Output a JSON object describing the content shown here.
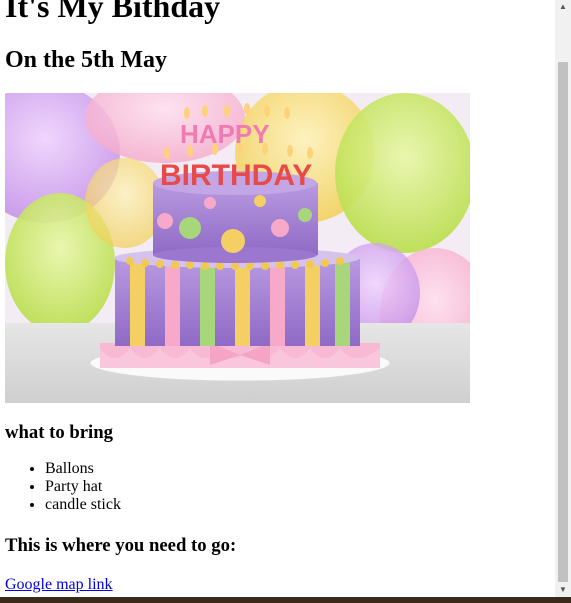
{
  "page": {
    "title": "It's My Bithday",
    "subtitle": "On the 5th May",
    "bring_heading": "what to bring",
    "bring_items": [
      "Ballons",
      "Party hat",
      "candle stick"
    ],
    "go_heading": "This is where you need to go:",
    "map_link_label": "Google map link"
  },
  "photo": {
    "description_hidden": "",
    "cake_text": "HAPPY BIRTHDAY"
  },
  "colors": {
    "link": "#0000ee",
    "bottom_bar": "#3a2a1c",
    "scrollbar_track": "#f1f1f1",
    "scrollbar_thumb": "#c1c1c1"
  }
}
